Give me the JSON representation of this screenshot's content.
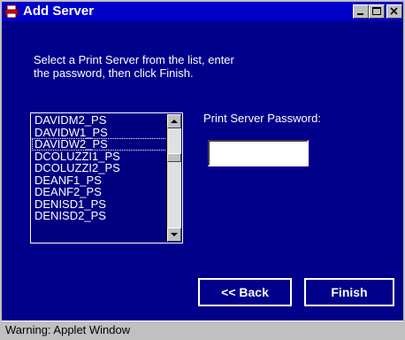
{
  "window": {
    "title": "Add Server",
    "title_icon": "printer-icon",
    "controls": {
      "minimize": "minimize-icon",
      "maximize": "maximize-icon",
      "close": "close-icon"
    }
  },
  "instructions": "Select a Print Server from the list, enter\nthe password, then click Finish.",
  "server_list": {
    "items": [
      "DAVIDM2_PS",
      "DAVIDW1_PS",
      "DAVIDW2_PS",
      "DCOLUZZI1_PS",
      "DCOLUZZI2_PS",
      "DEANF1_PS",
      "DEANF2_PS",
      "DENISD1_PS",
      "DENISD2_PS"
    ],
    "selected": "DAVIDW2_PS"
  },
  "password": {
    "label": "Print Server Password:",
    "value": ""
  },
  "buttons": {
    "back": "<< Back",
    "finish": "Finish"
  },
  "status": {
    "text": "Warning: Applet Window"
  },
  "colors": {
    "background": "#00008b",
    "title_bar": "#0000c8",
    "chrome": "#c0c0c0",
    "text": "#ffffff"
  }
}
